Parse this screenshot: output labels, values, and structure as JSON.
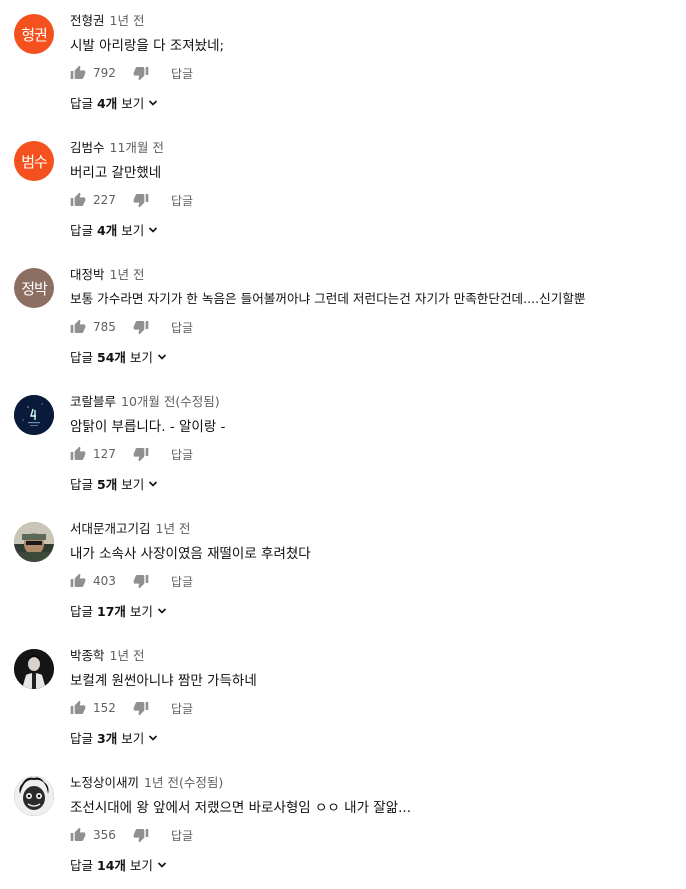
{
  "comments": [
    {
      "author": "전형권",
      "time": "1년 전",
      "avatar_text": "형권",
      "avatar_color": "#f4511e",
      "text": "시발 아리랑을 다 조져놨네;",
      "likes": "792",
      "reply_label": "답글",
      "replies_lead": "답글",
      "replies_count": "4개",
      "replies_tail": "보기"
    },
    {
      "author": "김범수",
      "time": "11개월 전",
      "avatar_text": "범수",
      "avatar_color": "#f4511e",
      "text": "버리고 갈만했네",
      "likes": "227",
      "reply_label": "답글",
      "replies_lead": "답글",
      "replies_count": "4개",
      "replies_tail": "보기"
    },
    {
      "author": "대정박",
      "time": "1년 전",
      "avatar_text": "정박",
      "avatar_color": "#8d6e63",
      "text": "보통 가수라면 자기가 한 녹음은 들어볼꺼아냐 그런데 저런다는건 자기가 만족한단건데....신기할뿐",
      "likes": "785",
      "reply_label": "답글",
      "replies_lead": "답글",
      "replies_count": "54개",
      "replies_tail": "보기"
    },
    {
      "author": "코랄블루",
      "time": "10개월 전(수정됨)",
      "avatar_text": "",
      "avatar_color": "#0a1a3a",
      "text": "암탉이 부릅니다. - 알이랑 -",
      "likes": "127",
      "reply_label": "답글",
      "replies_lead": "답글",
      "replies_count": "5개",
      "replies_tail": "보기"
    },
    {
      "author": "서대문개고기김",
      "time": "1년 전",
      "avatar_text": "",
      "avatar_color": "#6b7a6a",
      "text": "내가 소속사 사장이였음 재떨이로 후려쳤다",
      "likes": "403",
      "reply_label": "답글",
      "replies_lead": "답글",
      "replies_count": "17개",
      "replies_tail": "보기"
    },
    {
      "author": "박종학",
      "time": "1년 전",
      "avatar_text": "",
      "avatar_color": "#1a1a1a",
      "text": "보컬계 원썬아니냐 짬만 가득하네",
      "likes": "152",
      "reply_label": "답글",
      "replies_lead": "답글",
      "replies_count": "3개",
      "replies_tail": "보기"
    },
    {
      "author": "노정상이새끼",
      "time": "1년 전(수정됨)",
      "avatar_text": "",
      "avatar_color": "#2a2a2a",
      "text": "조선시대에 왕 앞에서 저랬으면 바로사형임 ㅇㅇ 내가 잘앎...",
      "likes": "356",
      "reply_label": "답글",
      "replies_lead": "답글",
      "replies_count": "14개",
      "replies_tail": "보기"
    }
  ]
}
